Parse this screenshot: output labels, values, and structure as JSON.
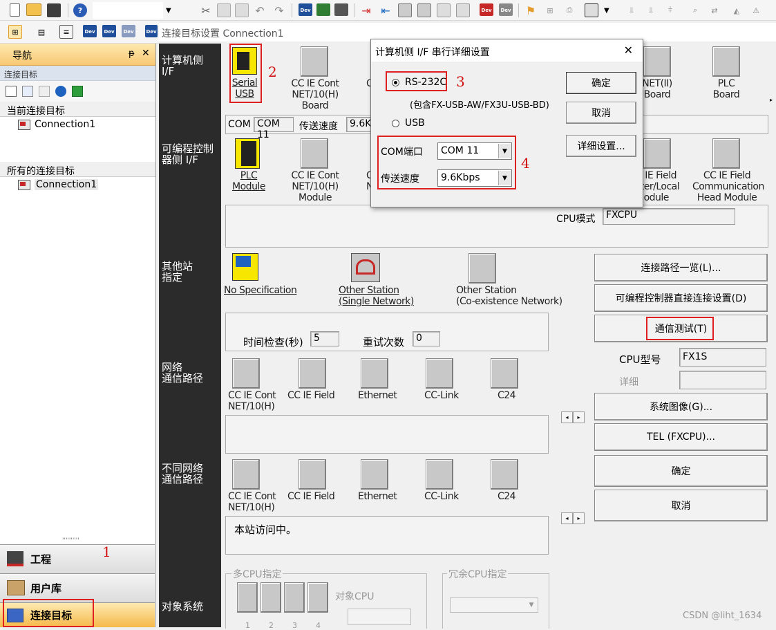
{
  "breadcrumb": "连接目标设置 Connection1",
  "nav": {
    "title": "导航",
    "pin": "ᵽ",
    "close": "✕",
    "section": "连接目标",
    "current_label": "当前连接目标",
    "current_item": "Connection1",
    "all_label": "所有的连接目标",
    "all_item": "Connection1",
    "bottom": [
      {
        "label": "工程"
      },
      {
        "label": "用户库"
      },
      {
        "label": "连接目标"
      }
    ],
    "grip": "''''''''''"
  },
  "sides": {
    "computer": "计算机侧\nI/F",
    "plc": "可编程控制\n器侧 I/F",
    "other": "其他站\n指定",
    "network": "网络\n通信路径",
    "diff_network": "不同网络\n通信路径",
    "target": "对象系统"
  },
  "computer_if": {
    "serial": "Serial\nUSB",
    "ccie": "CC IE Cont\nNET/10(H)\nBoard",
    "partial": "C",
    "net2": "NET(II)\nBoard",
    "plcboard": "PLC\nBoard"
  },
  "com_row": {
    "com_label": "COM",
    "com_value": "COM 11",
    "speed_label": "传送速度",
    "speed_value": "9.6Kb"
  },
  "plc_if": {
    "plc_module": "PLC\nModule",
    "ccie": "CC IE Cont\nNET/10(H)\nModule",
    "partial_c": "C",
    "partial_n": "N",
    "field_master": "C IE Field\nster/Local\nModule",
    "field_head": "CC IE Field\nCommunication\nHead Module"
  },
  "cpu_mode": {
    "label": "CPU模式",
    "value": "FXCPU"
  },
  "other_station": {
    "no_spec": "No Specification",
    "single": "Other Station\n(Single Network)",
    "coexist": "Other Station\n(Co-existence Network)"
  },
  "timing": {
    "time_label": "时间检查(秒)",
    "time_value": "5",
    "retry_label": "重试次数",
    "retry_value": "0"
  },
  "network_tiles": [
    "CC IE Cont\nNET/10(H)",
    "CC IE Field",
    "Ethernet",
    "CC-Link",
    "C24"
  ],
  "status_text": "本站访问中。",
  "right_buttons": {
    "route_list": "连接路径一览(L)...",
    "direct": "可编程控制器直接连接设置(D)",
    "comm_test": "通信测试(T)",
    "cpu_type_label": "CPU型号",
    "cpu_type_value": "FX1S",
    "detail_label": "详细",
    "system_image": "系统图像(G)...",
    "tel": "TEL (FXCPU)...",
    "ok": "确定",
    "cancel": "取消"
  },
  "multi_cpu": {
    "label": "多CPU指定",
    "target_cpu": "对象CPU",
    "nums": [
      "1",
      "2",
      "3",
      "4"
    ]
  },
  "redundant": {
    "label": "冗余CPU指定"
  },
  "dialog": {
    "title": "计算机侧 I/F 串行详细设置",
    "rs232": "RS-232C",
    "include": "(包含FX-USB-AW/FX3U-USB-BD)",
    "usb": "USB",
    "com_label": "COM端口",
    "com_value": "COM 11",
    "speed_label": "传送速度",
    "speed_value": "9.6Kbps",
    "ok": "确定",
    "cancel": "取消",
    "detail": "详细设置..."
  },
  "annotations": {
    "n1": "1",
    "n2": "2",
    "n3": "3",
    "n4": "4"
  },
  "watermark": "CSDN @liht_1634",
  "colors": {
    "highlight": "#e02020",
    "nav_orange": "#f8c873",
    "dark_bar": "#2b2b2b",
    "dev_icon": "#1f4e9a"
  }
}
